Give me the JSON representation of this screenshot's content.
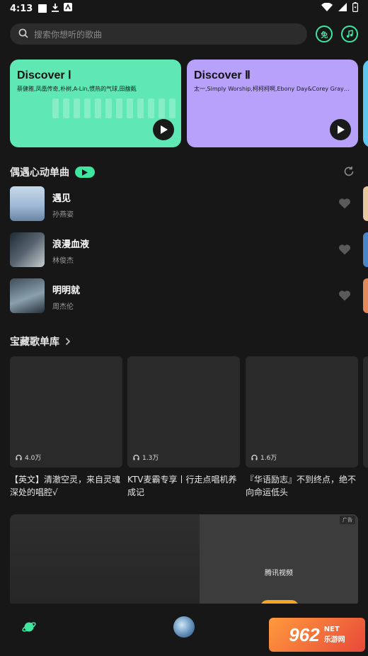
{
  "status_bar": {
    "time": "4:13"
  },
  "search": {
    "placeholder": "搜索你想听的歌曲"
  },
  "header_buttons": {
    "free_label": "免"
  },
  "discover": [
    {
      "title": "Discover Ⅰ",
      "artists": "蔡健雅,凤凰传奇,朴树,A-Lin,惯热的气球,田馥甄",
      "color": "#5fe8b3"
    },
    {
      "title": "Discover Ⅱ",
      "artists": "太一,Simply Worship,柯柯柯啊,Ebony Day&Corey Gray,海...",
      "color": "#b7a1fb"
    }
  ],
  "encounter": {
    "title": "偶遇心动单曲"
  },
  "songs": [
    {
      "name": "遇见",
      "artist": "孙燕姿"
    },
    {
      "name": "浪漫血液",
      "artist": "林俊杰"
    },
    {
      "name": "明明就",
      "artist": "周杰伦"
    }
  ],
  "library": {
    "title": "宝藏歌单库"
  },
  "playlists": [
    {
      "count": "4.0万",
      "title": "【英文】清澈空灵，来自灵魂深处的唱腔√"
    },
    {
      "count": "1.3万",
      "title": "KTV麦霸专享丨行走点唱机养成记"
    },
    {
      "count": "1.6万",
      "title": "『华语励志』不到终点，绝不向命运低头"
    }
  ],
  "ad": {
    "tag": "广告",
    "brand": "腾讯视频"
  },
  "watermark": {
    "number": "962",
    "suffix": "NET",
    "site": "乐游网"
  },
  "colors": {
    "accent": "#3ee6a0",
    "background": "#171717"
  }
}
